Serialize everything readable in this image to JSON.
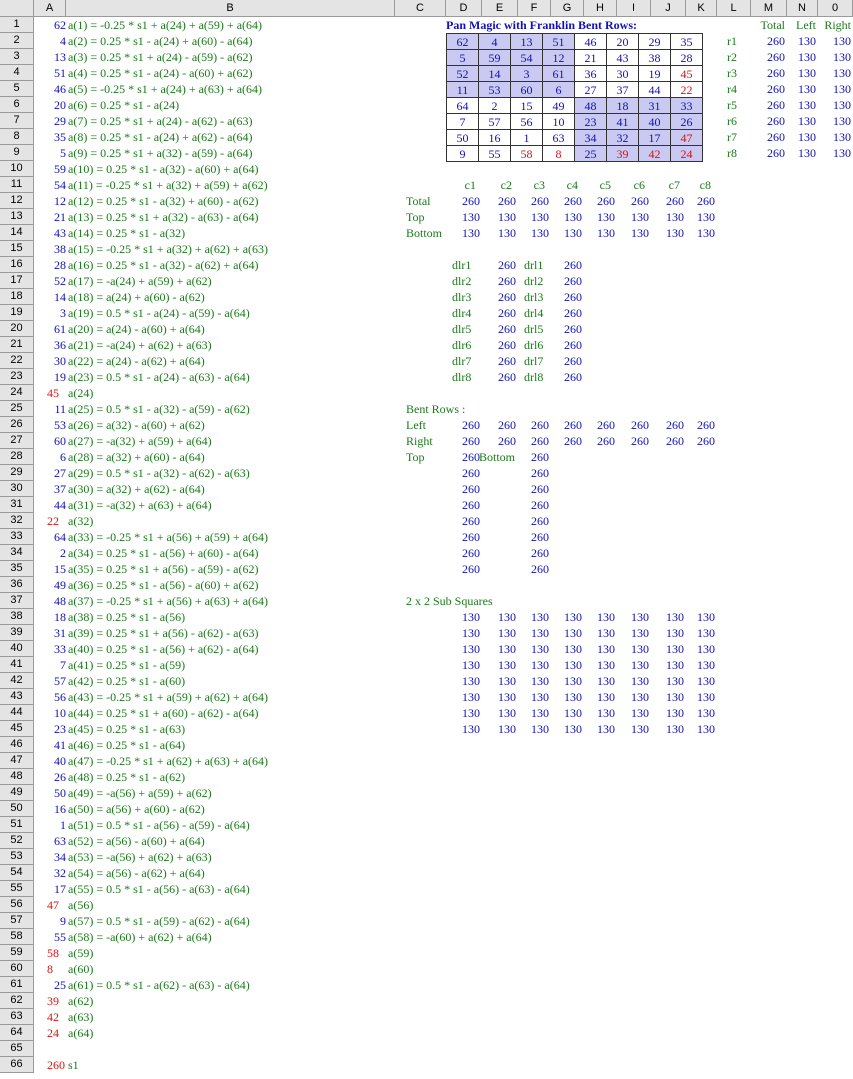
{
  "columns": [
    "A",
    "B",
    "C",
    "D",
    "E",
    "F",
    "G",
    "H",
    "I",
    "J",
    "K",
    "L",
    "M",
    "N",
    "0"
  ],
  "rows": [
    "1",
    "2",
    "3",
    "4",
    "5",
    "6",
    "7",
    "8",
    "9",
    "10",
    "11",
    "12",
    "13",
    "14",
    "15",
    "16",
    "17",
    "18",
    "19",
    "20",
    "21",
    "22",
    "23",
    "24",
    "25",
    "26",
    "27",
    "28",
    "29",
    "30",
    "31",
    "32",
    "33",
    "34",
    "35",
    "36",
    "37",
    "38",
    "39",
    "40",
    "41",
    "42",
    "43",
    "44",
    "45",
    "46",
    "47",
    "48",
    "49",
    "50",
    "51",
    "52",
    "53",
    "54",
    "55",
    "56",
    "57",
    "58",
    "59",
    "60",
    "61",
    "62",
    "63",
    "64",
    "65",
    "66"
  ],
  "formulas": [
    [
      "62",
      "a(1) = -0.25 * s1 + a(24) + a(59) + a(64)"
    ],
    [
      "4",
      "a(2) = 0.25 * s1 - a(24) + a(60) - a(64)"
    ],
    [
      "13",
      "a(3) = 0.25 * s1 + a(24) - a(59) - a(62)"
    ],
    [
      "51",
      "a(4) = 0.25 * s1 - a(24) - a(60) + a(62)"
    ],
    [
      "46",
      "a(5) = -0.25 * s1 + a(24) + a(63) + a(64)"
    ],
    [
      "20",
      "a(6) = 0.25 * s1 - a(24)"
    ],
    [
      "29",
      "a(7) = 0.25 * s1 + a(24) - a(62) - a(63)"
    ],
    [
      "35",
      "a(8) = 0.25 * s1 - a(24) + a(62) - a(64)"
    ],
    [
      "5",
      "a(9) = 0.25 * s1 + a(32) - a(59) - a(64)"
    ],
    [
      "59",
      "a(10) = 0.25 * s1 - a(32) - a(60) + a(64)"
    ],
    [
      "54",
      "a(11) = -0.25 * s1 + a(32) + a(59) + a(62)"
    ],
    [
      "12",
      "a(12) = 0.25 * s1 - a(32) + a(60) - a(62)"
    ],
    [
      "21",
      "a(13) = 0.25 * s1 + a(32) - a(63) - a(64)"
    ],
    [
      "43",
      "a(14) = 0.25 * s1 - a(32)"
    ],
    [
      "38",
      "a(15) = -0.25 * s1 + a(32) + a(62) + a(63)"
    ],
    [
      "28",
      "a(16) = 0.25 * s1 - a(32) - a(62) + a(64)"
    ],
    [
      "52",
      "a(17) = -a(24) + a(59) + a(62)"
    ],
    [
      "14",
      "a(18) = a(24) + a(60) - a(62)"
    ],
    [
      "3",
      "a(19) = 0.5 * s1 - a(24) - a(59) - a(64)"
    ],
    [
      "61",
      "a(20) = a(24) - a(60) + a(64)"
    ],
    [
      "36",
      "a(21) = -a(24) + a(62) + a(63)"
    ],
    [
      "30",
      "a(22) = a(24) - a(62) + a(64)"
    ],
    [
      "19",
      "a(23) = 0.5 * s1 - a(24) - a(63) - a(64)"
    ],
    [
      "45",
      "a(24)"
    ],
    [
      "11",
      "a(25) = 0.5 * s1 - a(32) - a(59) - a(62)"
    ],
    [
      "53",
      "a(26) = a(32) - a(60) + a(62)"
    ],
    [
      "60",
      "a(27) = -a(32) + a(59) + a(64)"
    ],
    [
      "6",
      "a(28) = a(32) + a(60) - a(64)"
    ],
    [
      "27",
      "a(29) = 0.5 * s1 - a(32) - a(62) - a(63)"
    ],
    [
      "37",
      "a(30) = a(32) + a(62) - a(64)"
    ],
    [
      "44",
      "a(31) = -a(32) + a(63) + a(64)"
    ],
    [
      "22",
      "a(32)"
    ],
    [
      "64",
      "a(33) = -0.25 * s1 + a(56) + a(59) + a(64)"
    ],
    [
      "2",
      "a(34) = 0.25 * s1 - a(56) + a(60) - a(64)"
    ],
    [
      "15",
      "a(35) = 0.25 * s1 + a(56) - a(59) - a(62)"
    ],
    [
      "49",
      "a(36) = 0.25 * s1 - a(56) - a(60) + a(62)"
    ],
    [
      "48",
      "a(37) = -0.25 * s1 + a(56) + a(63) + a(64)"
    ],
    [
      "18",
      "a(38) = 0.25 * s1 - a(56)"
    ],
    [
      "31",
      "a(39) = 0.25 * s1 + a(56) - a(62) - a(63)"
    ],
    [
      "33",
      "a(40) = 0.25 * s1 - a(56) + a(62) - a(64)"
    ],
    [
      "7",
      "a(41) = 0.25 * s1 - a(59)"
    ],
    [
      "57",
      "a(42) = 0.25 * s1 - a(60)"
    ],
    [
      "56",
      "a(43) = -0.25 * s1 + a(59) + a(62) + a(64)"
    ],
    [
      "10",
      "a(44) = 0.25 * s1 + a(60) - a(62) - a(64)"
    ],
    [
      "23",
      "a(45) = 0.25 * s1 - a(63)"
    ],
    [
      "41",
      "a(46) = 0.25 * s1 - a(64)"
    ],
    [
      "40",
      "a(47) = -0.25 * s1 + a(62) + a(63) + a(64)"
    ],
    [
      "26",
      "a(48) = 0.25 * s1 - a(62)"
    ],
    [
      "50",
      "a(49) = -a(56) + a(59) + a(62)"
    ],
    [
      "16",
      "a(50) = a(56) + a(60) - a(62)"
    ],
    [
      "1",
      "a(51) = 0.5 * s1 - a(56) - a(59) - a(64)"
    ],
    [
      "63",
      "a(52) = a(56) - a(60) + a(64)"
    ],
    [
      "34",
      "a(53) = -a(56) + a(62) + a(63)"
    ],
    [
      "32",
      "a(54) = a(56) - a(62) + a(64)"
    ],
    [
      "17",
      "a(55) = 0.5 * s1 - a(56) - a(63) - a(64)"
    ],
    [
      "47",
      "a(56)"
    ],
    [
      "9",
      "a(57) = 0.5 * s1 - a(59) - a(62) - a(64)"
    ],
    [
      "55",
      "a(58) = -a(60) + a(62) + a(64)"
    ],
    [
      "58",
      "a(59)"
    ],
    [
      "8",
      "a(60)"
    ],
    [
      "25",
      "a(61) = 0.5 * s1 - a(62) - a(63) - a(64)"
    ],
    [
      "39",
      "a(62)"
    ],
    [
      "42",
      "a(63)"
    ],
    [
      "24",
      "a(64)"
    ]
  ],
  "red_rows": [
    24,
    32,
    56,
    59,
    60,
    62,
    63,
    64
  ],
  "s1": {
    "value": "260",
    "label": "s1"
  },
  "title": "Pan Magic with Franklin Bent Rows:",
  "square": [
    [
      62,
      4,
      13,
      51,
      46,
      20,
      29,
      35
    ],
    [
      5,
      59,
      54,
      12,
      21,
      43,
      38,
      28
    ],
    [
      52,
      14,
      3,
      61,
      36,
      30,
      19,
      45
    ],
    [
      11,
      53,
      60,
      6,
      27,
      37,
      44,
      22
    ],
    [
      64,
      2,
      15,
      49,
      48,
      18,
      31,
      33
    ],
    [
      7,
      57,
      56,
      10,
      23,
      41,
      40,
      26
    ],
    [
      50,
      16,
      1,
      63,
      34,
      32,
      17,
      47
    ],
    [
      9,
      55,
      58,
      8,
      25,
      39,
      42,
      24
    ]
  ],
  "square_highlight": [
    [
      1,
      1,
      1,
      1,
      0,
      0,
      0,
      0
    ],
    [
      1,
      1,
      1,
      1,
      0,
      0,
      0,
      0
    ],
    [
      1,
      1,
      1,
      1,
      0,
      0,
      0,
      0
    ],
    [
      1,
      1,
      1,
      1,
      0,
      0,
      0,
      0
    ],
    [
      0,
      0,
      0,
      0,
      1,
      1,
      1,
      1
    ],
    [
      0,
      0,
      0,
      0,
      1,
      1,
      1,
      1
    ],
    [
      0,
      0,
      0,
      0,
      1,
      1,
      1,
      1
    ],
    [
      0,
      0,
      0,
      0,
      1,
      1,
      1,
      1
    ]
  ],
  "square_red": [
    [
      0,
      0,
      0,
      0,
      0,
      0,
      0,
      0
    ],
    [
      0,
      0,
      0,
      0,
      0,
      0,
      0,
      0
    ],
    [
      0,
      0,
      0,
      0,
      0,
      0,
      0,
      1
    ],
    [
      0,
      0,
      0,
      0,
      0,
      0,
      0,
      1
    ],
    [
      0,
      0,
      0,
      0,
      0,
      0,
      0,
      0
    ],
    [
      0,
      0,
      0,
      0,
      0,
      0,
      0,
      0
    ],
    [
      0,
      0,
      0,
      0,
      0,
      0,
      0,
      1
    ],
    [
      0,
      0,
      1,
      1,
      0,
      1,
      1,
      1
    ]
  ],
  "row_sums": {
    "headers": [
      "Total",
      "Left",
      "Right"
    ],
    "labels": [
      "r1",
      "r2",
      "r3",
      "r4",
      "r5",
      "r6",
      "r7",
      "r8"
    ],
    "values": [
      [
        "260",
        "130",
        "130"
      ],
      [
        "260",
        "130",
        "130"
      ],
      [
        "260",
        "130",
        "130"
      ],
      [
        "260",
        "130",
        "130"
      ],
      [
        "260",
        "130",
        "130"
      ],
      [
        "260",
        "130",
        "130"
      ],
      [
        "260",
        "130",
        "130"
      ],
      [
        "260",
        "130",
        "130"
      ]
    ]
  },
  "col_sums": {
    "headers": [
      "c1",
      "c2",
      "c3",
      "c4",
      "c5",
      "c6",
      "c7",
      "c8"
    ],
    "rows": [
      {
        "label": "Total",
        "values": [
          "260",
          "260",
          "260",
          "260",
          "260",
          "260",
          "260",
          "260"
        ]
      },
      {
        "label": "Top",
        "values": [
          "130",
          "130",
          "130",
          "130",
          "130",
          "130",
          "130",
          "130"
        ]
      },
      {
        "label": "Bottom",
        "values": [
          "130",
          "130",
          "130",
          "130",
          "130",
          "130",
          "130",
          "130"
        ]
      }
    ]
  },
  "diagonals": [
    [
      "dlr1",
      "260",
      "drl1",
      "260"
    ],
    [
      "dlr2",
      "260",
      "drl2",
      "260"
    ],
    [
      "dlr3",
      "260",
      "drl3",
      "260"
    ],
    [
      "dlr4",
      "260",
      "drl4",
      "260"
    ],
    [
      "dlr5",
      "260",
      "drl5",
      "260"
    ],
    [
      "dlr6",
      "260",
      "drl6",
      "260"
    ],
    [
      "dlr7",
      "260",
      "drl7",
      "260"
    ],
    [
      "dlr8",
      "260",
      "drl8",
      "260"
    ]
  ],
  "bent_rows": {
    "label": "Bent Rows :",
    "left_label": "Left",
    "left": [
      "260",
      "260",
      "260",
      "260",
      "260",
      "260",
      "260",
      "260"
    ],
    "right_label": "Right",
    "right": [
      "260",
      "260",
      "260",
      "260",
      "260",
      "260",
      "260",
      "260"
    ],
    "top_label": "Top",
    "bottom_label": "Bottom",
    "top": [
      "260",
      "260",
      "260",
      "260",
      "260",
      "260",
      "260",
      "260"
    ],
    "bottom": [
      "260",
      "260",
      "260",
      "260",
      "260",
      "260",
      "260",
      "260"
    ]
  },
  "subsquares": {
    "label": "2 x 2 Sub Squares",
    "values": [
      [
        "130",
        "130",
        "130",
        "130",
        "130",
        "130",
        "130",
        "130"
      ],
      [
        "130",
        "130",
        "130",
        "130",
        "130",
        "130",
        "130",
        "130"
      ],
      [
        "130",
        "130",
        "130",
        "130",
        "130",
        "130",
        "130",
        "130"
      ],
      [
        "130",
        "130",
        "130",
        "130",
        "130",
        "130",
        "130",
        "130"
      ],
      [
        "130",
        "130",
        "130",
        "130",
        "130",
        "130",
        "130",
        "130"
      ],
      [
        "130",
        "130",
        "130",
        "130",
        "130",
        "130",
        "130",
        "130"
      ],
      [
        "130",
        "130",
        "130",
        "130",
        "130",
        "130",
        "130",
        "130"
      ],
      [
        "130",
        "130",
        "130",
        "130",
        "130",
        "130",
        "130",
        "130"
      ]
    ]
  }
}
